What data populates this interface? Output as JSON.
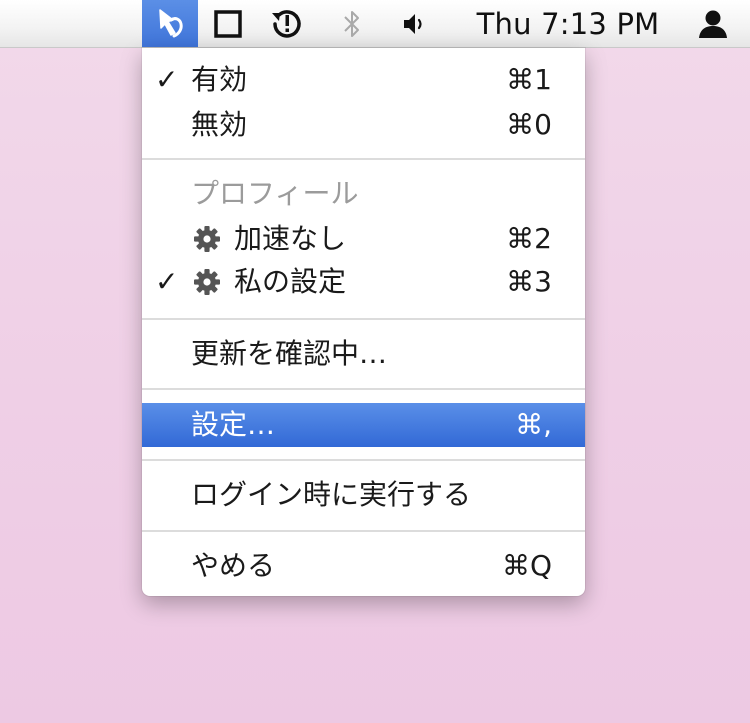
{
  "menubar": {
    "app_icon": "hand-pointer-icon",
    "window_icon": "window-icon",
    "timemachine_icon": "time-machine-icon",
    "bluetooth_icon": "bluetooth-icon",
    "volume_icon": "speaker-icon",
    "clock": "Thu 7:13 PM",
    "user_icon": "user-icon"
  },
  "menu": {
    "enable": {
      "label": "有効",
      "shortcut": "⌘1",
      "checked": true
    },
    "disable": {
      "label": "無効",
      "shortcut": "⌘0"
    },
    "profiles_header": "プロフィール",
    "profile_no_accel": {
      "label": "加速なし",
      "shortcut": "⌘2",
      "icon": "gear-icon"
    },
    "profile_my_settings": {
      "label": "私の設定",
      "shortcut": "⌘3",
      "icon": "gear-icon",
      "checked": true
    },
    "check_updates": {
      "label": "更新を確認中…"
    },
    "preferences": {
      "label": "設定…",
      "shortcut": "⌘,",
      "highlighted": true
    },
    "launch_at_login": {
      "label": "ログイン時に実行する"
    },
    "quit": {
      "label": "やめる",
      "shortcut": "⌘Q"
    },
    "checkmark": "✓",
    "highlight_color": "#3f74d9"
  }
}
